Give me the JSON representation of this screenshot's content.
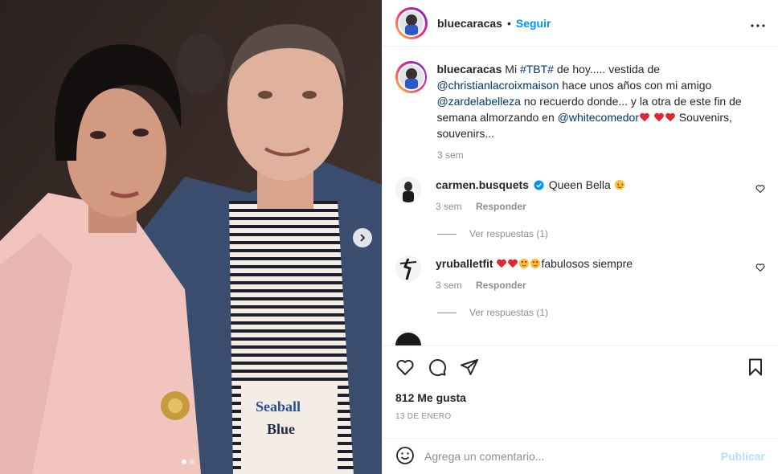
{
  "colors": {
    "link": "#00376b",
    "follow": "#0095f6",
    "publish_disabled": "#b2dffc",
    "muted": "#8e8e8e",
    "heart": "#ed4956"
  },
  "header": {
    "username": "bluecaracas",
    "separator": "•",
    "follow_label": "Seguir",
    "more_icon": "more-icon"
  },
  "caption": {
    "username": "bluecaracas",
    "t1": "Mi ",
    "hashtag": "#TBT#",
    "t2": " de hoy..... vestida de ",
    "mention1": "@christianlacroixmaison",
    "t3": " hace unos años con mi amigo ",
    "mention2": "@zardelabelleza",
    "t4": " no recuerdo donde... y la otra de este fin de semana almorzando en ",
    "mention3": "@whitecomedor",
    "t5": " Souvenirs, souvenirs...",
    "time": "3 sem"
  },
  "comments": [
    {
      "username": "carmen.busquets",
      "verified": true,
      "text": "Queen Bella",
      "time": "3 sem",
      "reply_label": "Responder",
      "view_replies": "Ver respuestas (1)"
    },
    {
      "username": "yruballetfit",
      "verified": false,
      "text": "fabulosos siempre",
      "time": "3 sem",
      "reply_label": "Responder",
      "view_replies": "Ver respuestas (1)"
    }
  ],
  "actions": {
    "likes": "812 Me gusta",
    "date": "13 DE ENERO"
  },
  "add_comment": {
    "placeholder": "Agrega un comentario...",
    "publish_label": "Publicar"
  },
  "carousel": {
    "total": 2,
    "active": 1
  }
}
